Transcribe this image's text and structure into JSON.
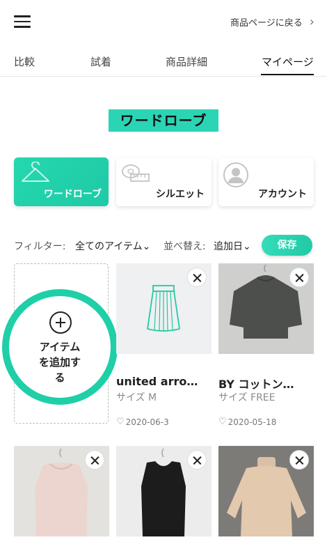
{
  "header": {
    "back_label": "商品ページに戻る"
  },
  "tabs": [
    {
      "label": "比較"
    },
    {
      "label": "試着"
    },
    {
      "label": "商品詳細"
    },
    {
      "label": "マイページ"
    }
  ],
  "page_title": "ワードローブ",
  "categories": [
    {
      "label": "ワードローブ"
    },
    {
      "label": "シルエット"
    },
    {
      "label": "アカウント"
    }
  ],
  "filter": {
    "filter_label": "フィルター:",
    "filter_value": "全てのアイテム",
    "sort_label": "並べ替え:",
    "sort_value": "追加日",
    "save_label": "保存"
  },
  "add_item": {
    "line1": "アイテム",
    "line2": "を追加す",
    "line3": "る"
  },
  "items": [
    {
      "name": "united arro…",
      "size": "サイズ M",
      "date": "2020-06-3"
    },
    {
      "name": "BY コットン…",
      "size": "サイズ FREE",
      "date": "2020-05-18"
    }
  ],
  "colors": {
    "accent": "#1fcfa8",
    "title_highlight": "#2bd4b4"
  }
}
